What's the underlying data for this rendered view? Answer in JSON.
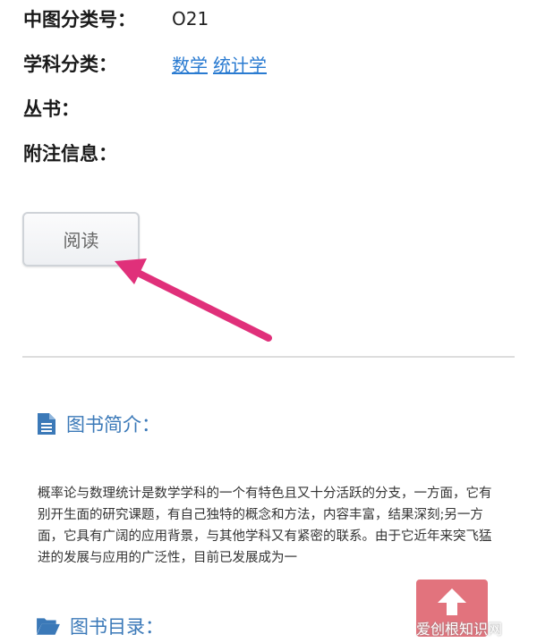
{
  "meta": {
    "clc_label": "中图分类号：",
    "clc_value": "O21",
    "subject_label": "学科分类：",
    "subject_links": [
      "数学",
      "统计学"
    ],
    "series_label": "丛书：",
    "note_label": "附注信息："
  },
  "actions": {
    "read_label": "阅读"
  },
  "intro": {
    "title": "图书简介：",
    "text": "概率论与数理统计是数学学科的一个有特色且又十分活跃的分支，一方面，它有别开生面的研究课题，有自己独特的概念和方法，内容丰富，结果深刻;另一方面，它具有广阔的应用背景，与其他学科又有紧密的联系。由于它近年来突飞猛进的发展与应用的广泛性，目前已发展成为一"
  },
  "toc": {
    "title": "图书目录："
  },
  "watermark": {
    "text": "爱创根知识网"
  },
  "colors": {
    "link": "#2a7bd1",
    "section": "#3b79b8",
    "arrow": "#e0307a",
    "watermark": "#e06873"
  }
}
